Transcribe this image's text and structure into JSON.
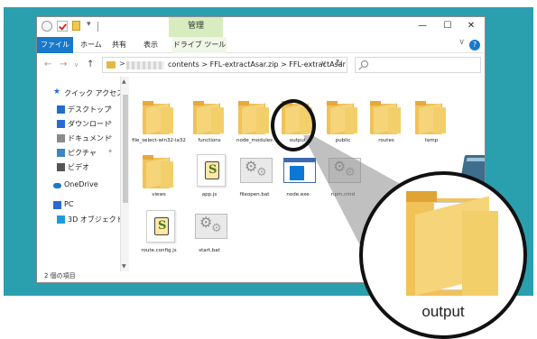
{
  "titlebar": {
    "manage_tab": "管理",
    "minimize": "—",
    "maximize": "☐",
    "close": "✕",
    "dropdown": "▾"
  },
  "ribbon": {
    "tabs": [
      {
        "label": "ファイル"
      },
      {
        "label": "ホーム"
      },
      {
        "label": "共有"
      },
      {
        "label": "表示"
      },
      {
        "label": "ドライブ ツール"
      }
    ],
    "collapse": "∨",
    "help": "?"
  },
  "address": {
    "back": "←",
    "forward": "→",
    "history": "∨",
    "up": "↑",
    "sep": ">",
    "path": "contents  >  FFL-extractAsar.zip  >  FFL-extractAsar",
    "dropdown": "∨",
    "refresh": "↻",
    "search_placeholder": ""
  },
  "navpane": {
    "items": [
      {
        "label": "クイック アクセス",
        "icon": "star-icon"
      },
      {
        "label": "デスクトップ",
        "icon": "desktop-icon",
        "pin": "📌"
      },
      {
        "label": "ダウンロード",
        "icon": "download-icon",
        "pin": "📌"
      },
      {
        "label": "ドキュメント",
        "icon": "document-icon",
        "pin": "📌"
      },
      {
        "label": "ピクチャ",
        "icon": "picture-icon",
        "pin": "📌"
      },
      {
        "label": "ビデオ",
        "icon": "video-icon"
      },
      {
        "label": "OneDrive",
        "icon": "cloud-icon"
      },
      {
        "label": "PC",
        "icon": "pc-icon"
      },
      {
        "label": "3D オブジェクト",
        "icon": "cube-icon"
      }
    ],
    "scroll_up": "▲",
    "scroll_down": "▼"
  },
  "status": {
    "text": "2 個の項目"
  },
  "files": [
    {
      "name": "file_select-win32-ia32",
      "type": "folder"
    },
    {
      "name": "functions",
      "type": "folder"
    },
    {
      "name": "node_modules",
      "type": "folder"
    },
    {
      "name": "output",
      "type": "folder"
    },
    {
      "name": "public",
      "type": "folder"
    },
    {
      "name": "routes",
      "type": "folder"
    },
    {
      "name": "temp",
      "type": "folder"
    },
    {
      "name": "views",
      "type": "folder"
    },
    {
      "name": "app.js",
      "type": "js"
    },
    {
      "name": "fileopen.bat",
      "type": "bat"
    },
    {
      "name": "node.exe",
      "type": "exe"
    },
    {
      "name": "npm.cmd",
      "type": "bat"
    },
    {
      "name": "route.config.js",
      "type": "js"
    },
    {
      "name": "start.bat",
      "type": "bat"
    }
  ],
  "callout": {
    "label": "output",
    "icon": "folder-icon"
  },
  "colors": {
    "background": "#2a9fae",
    "file_tab": "#1979ca",
    "manage_tab": "#d7ecbf",
    "folder": "#f1c258"
  }
}
